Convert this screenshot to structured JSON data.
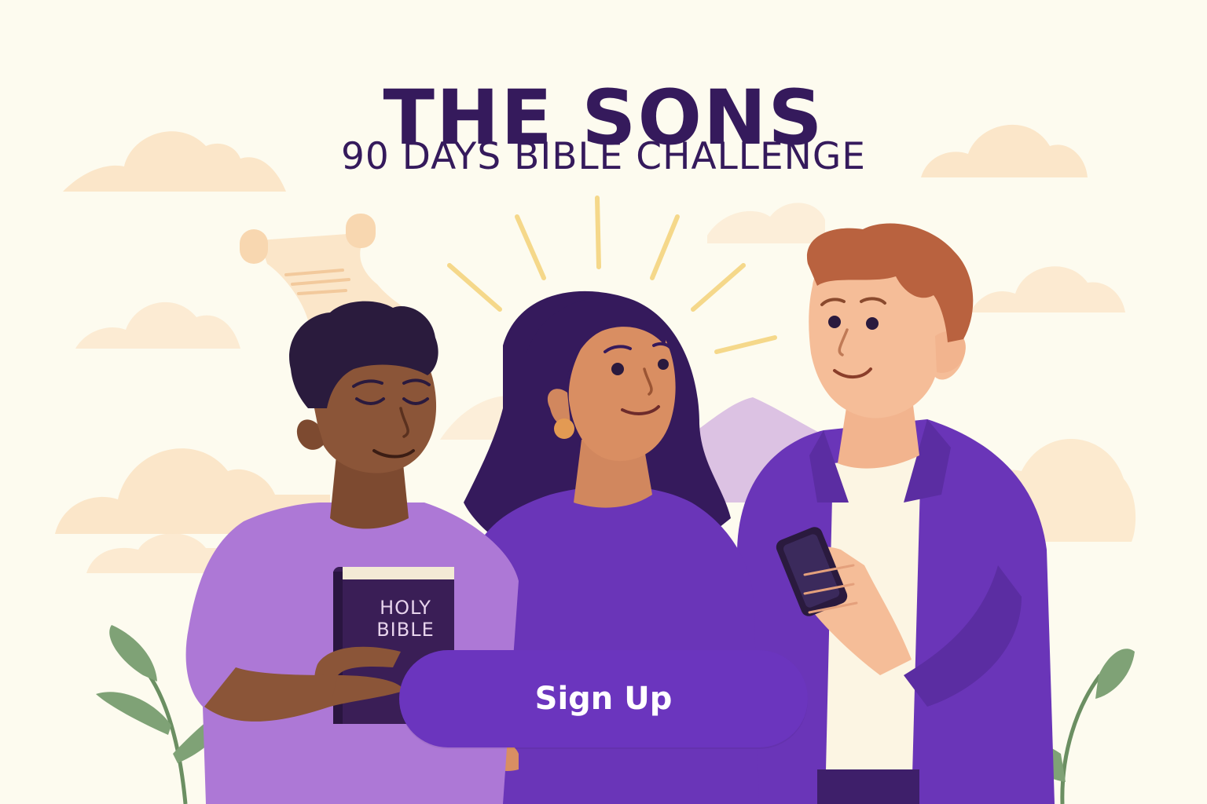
{
  "header": {
    "title": "THE SONS",
    "subtitle": "90 DAYS BIBLE CHALLENGE"
  },
  "bible": {
    "line1": "HOLY",
    "line2": "BIBLE"
  },
  "cta": {
    "label": "Sign Up"
  },
  "colors": {
    "background": "#fdfbef",
    "title": "#351a5c",
    "button": "#6b35be",
    "button_text": "#ffffff",
    "cloud": "#fbe6c9",
    "mountain": "#dcc2e3",
    "rays": "#f5d88a",
    "leaf": "#7fa276"
  }
}
